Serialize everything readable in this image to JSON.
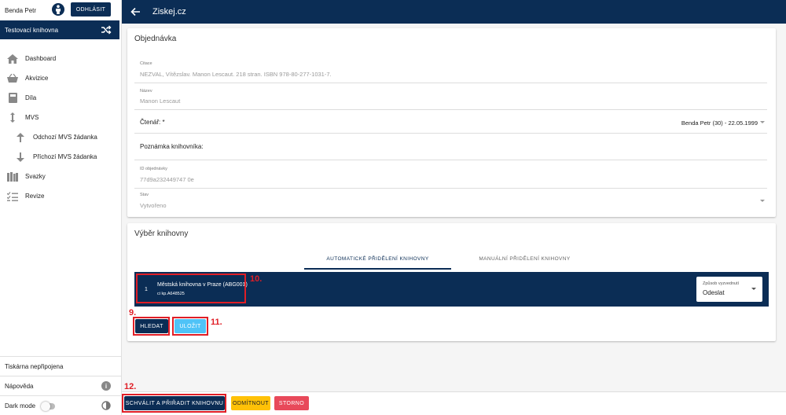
{
  "user": {
    "name": "Benda Petr",
    "logout_label": "ODHLÁSIT"
  },
  "library": {
    "name": "Testovací knihovna"
  },
  "nav": {
    "dashboard": "Dashboard",
    "akvizice": "Akvizice",
    "dila": "Díla",
    "mvs": "MVS",
    "odchozi": "Odchozí MVS žádanka",
    "prichozi": "Příchozí MVS žádanka",
    "svazky": "Svazky",
    "revize": "Revize"
  },
  "bottom": {
    "printer": "Tiskárna nepřipojena",
    "help": "Nápověda",
    "dark_mode": "Dark mode"
  },
  "topbar": {
    "title": "Ziskej.cz"
  },
  "order": {
    "title": "Objednávka",
    "citation_label": "Citace",
    "citation_value": "NEZVAL, Vítězslav. Manon Lescaut. 218 stran. ISBN 978-80-277-1031-7.",
    "name_label": "Název",
    "name_value": "Manon Lescaut",
    "reader_label": "Čtenář: *",
    "reader_value": "Benda Petr (30) - 22.05.1999",
    "note_label": "Poznámka knihovníka:",
    "id_label": "ID objednávky",
    "id_value": "77d9a232449747 0e",
    "state_label": "Stav",
    "state_value": "Vytvořeno"
  },
  "selection": {
    "title": "Výběr knihovny",
    "tab_auto": "AUTOMATICKÉ PŘIDĚLENÍ KNIHOVNY",
    "tab_manual": "MANUÁLNÍ PŘIDĚLENÍ KNIHOVNY",
    "row_num": "1",
    "library_name": "Městská knihovna v Praze (ABG001)",
    "signature": "ci kp.A648525",
    "method_label": "Způsob vyzvednutí",
    "method_value": "Odeslat",
    "search_label": "HLEDAT",
    "save_label": "ULOŽIT"
  },
  "actions": {
    "approve": "SCHVÁLIT A PŘIŘADIT KNIHOVNU",
    "reject": "ODMÍTNOUT",
    "cancel": "STORNO"
  },
  "annotations": {
    "a9": "9.",
    "a10": "10.",
    "a11": "11.",
    "a12": "12."
  },
  "colors": {
    "primary": "#0b2d55",
    "save": "#4fc3f7",
    "reject": "#ffc107",
    "cancel": "#e8495a",
    "annotation": "#e01e26"
  }
}
